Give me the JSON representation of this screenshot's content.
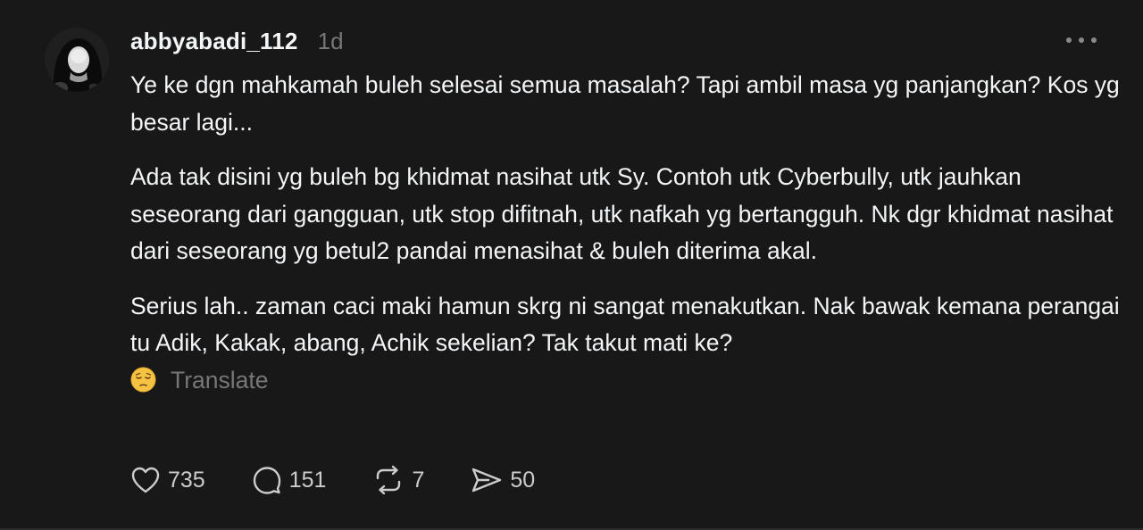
{
  "post": {
    "username": "abbyabadi_112",
    "time": "1d",
    "paragraphs": [
      "Ye ke dgn mahkamah buleh selesai semua masalah? Tapi ambil masa yg panjangkan? Kos yg besar lagi...",
      "Ada tak disini yg buleh bg khidmat nasihat utk Sy. Contoh utk Cyberbully, utk jauhkan seseorang dari gangguan, utk stop difitnah, utk nafkah yg bertangguh. Nk dgr khidmat nasihat dari seseorang yg betul2 pandai menasihat & buleh diterima akal.",
      "Serius lah.. zaman caci maki hamun skrg ni sangat menakutkan. Nak bawak kemana perangai tu Adik, Kakak, abang, Achik sekelian? Tak takut mati ke?"
    ],
    "translate_label": "Translate",
    "emoji_icon": "pensive-face-icon"
  },
  "actions": {
    "likes": "735",
    "comments": "151",
    "reposts": "7",
    "shares": "50",
    "icons": [
      "heart-icon",
      "comment-icon",
      "repost-icon",
      "share-icon"
    ]
  },
  "colors": {
    "background": "#181818",
    "text": "#f3f5f7",
    "muted": "#777777",
    "counts": "#cccccc"
  }
}
